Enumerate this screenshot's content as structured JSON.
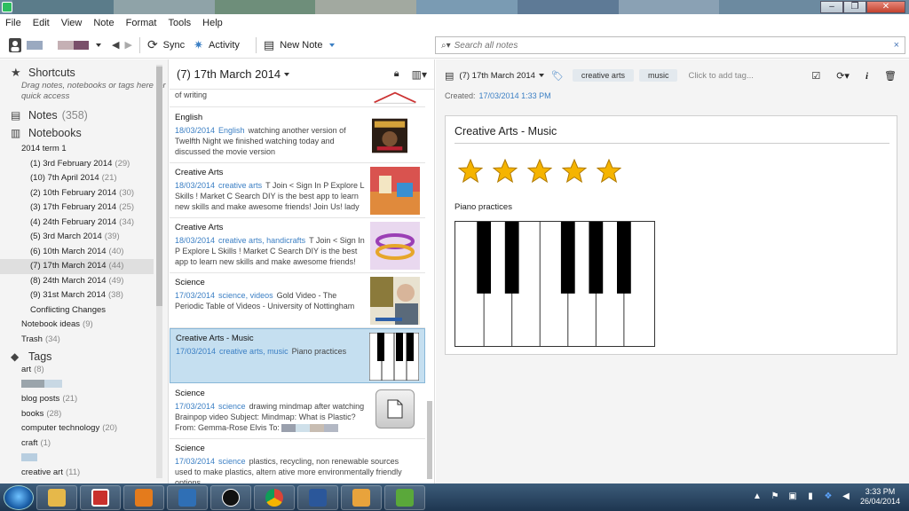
{
  "menu": [
    "File",
    "Edit",
    "View",
    "Note",
    "Format",
    "Tools",
    "Help"
  ],
  "toolbar": {
    "sync": "Sync",
    "activity": "Activity",
    "new_note": "New Note"
  },
  "search": {
    "placeholder": "Search all notes",
    "clear": "×"
  },
  "sidebar": {
    "shortcuts": "Shortcuts",
    "shortcuts_hint": "Drag notes, notebooks or tags here for quick access",
    "notes_label": "Notes",
    "notes_count": "(358)",
    "notebooks_label": "Notebooks",
    "stack": "2014 term 1",
    "notebooks": [
      {
        "name": "(1) 3rd February 2014",
        "count": "(29)"
      },
      {
        "name": "(10) 7th April 2014",
        "count": "(21)"
      },
      {
        "name": "(2) 10th February 2014",
        "count": "(30)"
      },
      {
        "name": "(3) 17th February 2014",
        "count": "(25)"
      },
      {
        "name": "(4) 24th February 2014",
        "count": "(34)"
      },
      {
        "name": "(5) 3rd March 2014",
        "count": "(39)"
      },
      {
        "name": "(6) 10th March 2014",
        "count": "(40)"
      },
      {
        "name": "(7) 17th March 2014",
        "count": "(44)"
      },
      {
        "name": "(8) 24th March 2014",
        "count": "(49)"
      },
      {
        "name": "(9) 31st March 2014",
        "count": "(38)"
      },
      {
        "name": "Conflicting Changes",
        "count": ""
      }
    ],
    "other": [
      {
        "name": "Notebook ideas",
        "count": "(9)"
      },
      {
        "name": "Trash",
        "count": "(34)"
      }
    ],
    "tags_label": "Tags",
    "tags": [
      {
        "name": "art",
        "count": "(8)"
      },
      {
        "name": "blog posts",
        "count": "(21)"
      },
      {
        "name": "books",
        "count": "(28)"
      },
      {
        "name": "computer technology",
        "count": "(20)"
      },
      {
        "name": "craft",
        "count": "(1)"
      },
      {
        "name": "creative art",
        "count": "(11)"
      }
    ]
  },
  "notelist": {
    "title": "(7) 17th March 2014",
    "partial_top": "of writing",
    "notes": [
      {
        "title": "English",
        "date": "18/03/2014",
        "tags": "English",
        "snippet": "watching another version of Twelfth Night we finished watching today and discussed the movie version"
      },
      {
        "title": "Creative Arts",
        "date": "18/03/2014",
        "tags": "creative arts",
        "snippet": "T Join < Sign In P Explore L Skills ! Market C Search DIY is the best app to learn new skills and make awesome friends! Join Us! lady ..."
      },
      {
        "title": "Creative Arts",
        "date": "18/03/2014",
        "tags": "creative arts, handicrafts",
        "snippet": "T Join < Sign In P Explore L Skills ! Market C Search DIY is the best app to learn new skills and make awesome friends! Join ..."
      },
      {
        "title": "Science",
        "date": "17/03/2014",
        "tags": "science, videos",
        "snippet": "Gold Video - The Periodic Table of Videos - University of Nottingham"
      },
      {
        "title": "Creative Arts - Music",
        "date": "17/03/2014",
        "tags": "creative arts, music",
        "snippet": "Piano practices"
      },
      {
        "title": "Science",
        "date": "17/03/2014",
        "tags": "science",
        "snippet": "drawing mindmap after watching Brainpop video Subject: Mindmap: What is Plastic? From: Gemma-Rose Elvis To:"
      },
      {
        "title": "Science",
        "date": "17/03/2014",
        "tags": "science",
        "snippet": "plastics, recycling, non renewable sources used to make plastics, altern ative more environmentally friendly options"
      }
    ]
  },
  "editor": {
    "notebook": "(7) 17th March 2014",
    "tags": [
      "creative arts",
      "music"
    ],
    "add_tag": "Click to add tag...",
    "created_label": "Created:",
    "created_value": "17/03/2014 1:33 PM",
    "note_title": "Creative Arts - Music",
    "stars": 5,
    "subtitle": "Piano practices"
  },
  "taskbar": {
    "time": "3:33 PM",
    "date": "26/04/2014"
  },
  "colors": {
    "accent": "#3b7fc4",
    "selected": "#c5dff0",
    "star": "#f5b400"
  }
}
